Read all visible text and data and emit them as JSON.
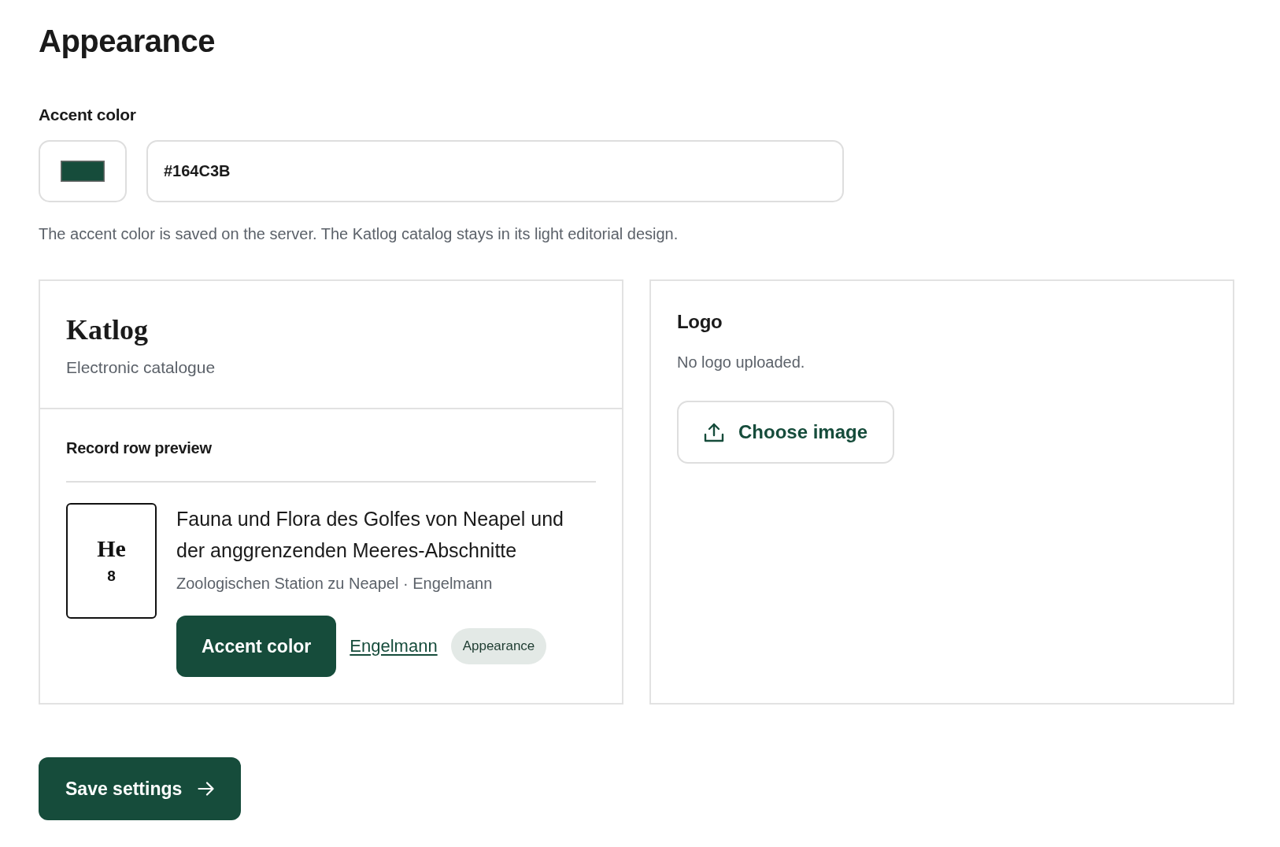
{
  "page": {
    "title": "Appearance"
  },
  "accent_color": {
    "label": "Accent color",
    "color": "#164c3b",
    "value": "#164C3B",
    "help": "The accent color is saved on the server. The Katlog catalog stays in its light editorial design."
  },
  "preview_card": {
    "brand": "Katlog",
    "tagline": "Electronic catalogue",
    "section_title": "Record row preview",
    "record": {
      "shelf_mark": "He",
      "shelf_number": "8",
      "title": "Fauna und Flora des Golfes von Neapel und der anggrenzenden Meeres-Abschnitte",
      "meta": "Zoologischen Station zu Neapel · Engelmann",
      "actions": [
        {
          "kind": "button",
          "label": "Accent color"
        },
        {
          "kind": "link",
          "label": "Engelmann"
        },
        {
          "kind": "tag",
          "label": "Appearance"
        }
      ]
    }
  },
  "logo_card": {
    "title": "Logo",
    "status": "No logo uploaded.",
    "button": "Choose image"
  },
  "save_button": {
    "label": "Save settings"
  }
}
